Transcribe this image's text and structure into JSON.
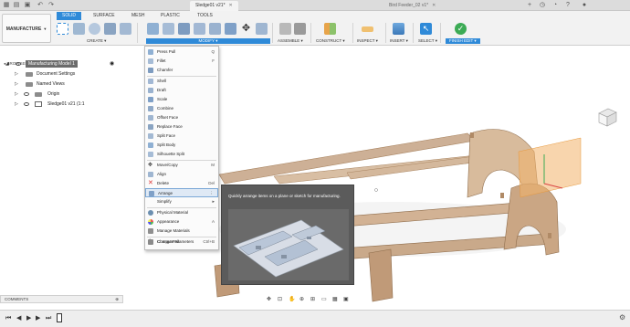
{
  "tabs": {
    "active": {
      "title": "Sledge01 v21*"
    },
    "inactive": {
      "title": "Bird Feeder_02 v1*"
    }
  },
  "workspace": {
    "label": "MANUFACTURE"
  },
  "ws_tabs": [
    "SOLID",
    "SURFACE",
    "MESH",
    "PLASTIC",
    "TOOLS"
  ],
  "groups": {
    "create": "CREATE",
    "modify": "MODIFY",
    "assemble": "ASSEMBLE",
    "construct": "CONSTRUCT",
    "inspect": "INSPECT",
    "insert": "INSERT",
    "select": "SELECT",
    "finish": "FINISH EDIT"
  },
  "browser": {
    "header": "BROWSER",
    "root": "Manufacturing Model 1",
    "items": [
      "Document Settings",
      "Named Views",
      "Origin",
      "Sledge01 v21 (1:1"
    ]
  },
  "menu": {
    "items": [
      {
        "label": "Press Pull",
        "key": "Q"
      },
      {
        "label": "Fillet",
        "key": "F"
      },
      {
        "label": "Chamfer",
        "key": ""
      },
      {
        "label": "Shell",
        "key": ""
      },
      {
        "label": "Draft",
        "key": ""
      },
      {
        "label": "Scale",
        "key": ""
      },
      {
        "label": "Combine",
        "key": ""
      },
      {
        "label": "Offset Face",
        "key": ""
      },
      {
        "label": "Replace Face",
        "key": ""
      },
      {
        "label": "Split Face",
        "key": ""
      },
      {
        "label": "Split Body",
        "key": ""
      },
      {
        "label": "Silhouette Split",
        "key": ""
      },
      {
        "label": "Move/Copy",
        "key": "M"
      },
      {
        "label": "Align",
        "key": ""
      },
      {
        "label": "Delete",
        "key": "Del"
      },
      {
        "label": "Arrange",
        "key": "⋮"
      },
      {
        "label": "Simplify",
        "key": "▸"
      },
      {
        "label": "Physical Material",
        "key": ""
      },
      {
        "label": "Appearance",
        "key": "A"
      },
      {
        "label": "Manage Materials",
        "key": ""
      },
      {
        "label": "Change Parameters",
        "key": ""
      },
      {
        "label": "Compute All",
        "key": "Ctrl+B"
      }
    ]
  },
  "tooltip": {
    "text": "Quickly arrange items on a plane or sketch for manufacturing."
  },
  "comments": {
    "label": "COMMENTS"
  },
  "colors": {
    "accent": "#2f8ad8",
    "wood": "#c9a98a",
    "wood_dark": "#a8835f",
    "highlight": "#f3b36a"
  }
}
